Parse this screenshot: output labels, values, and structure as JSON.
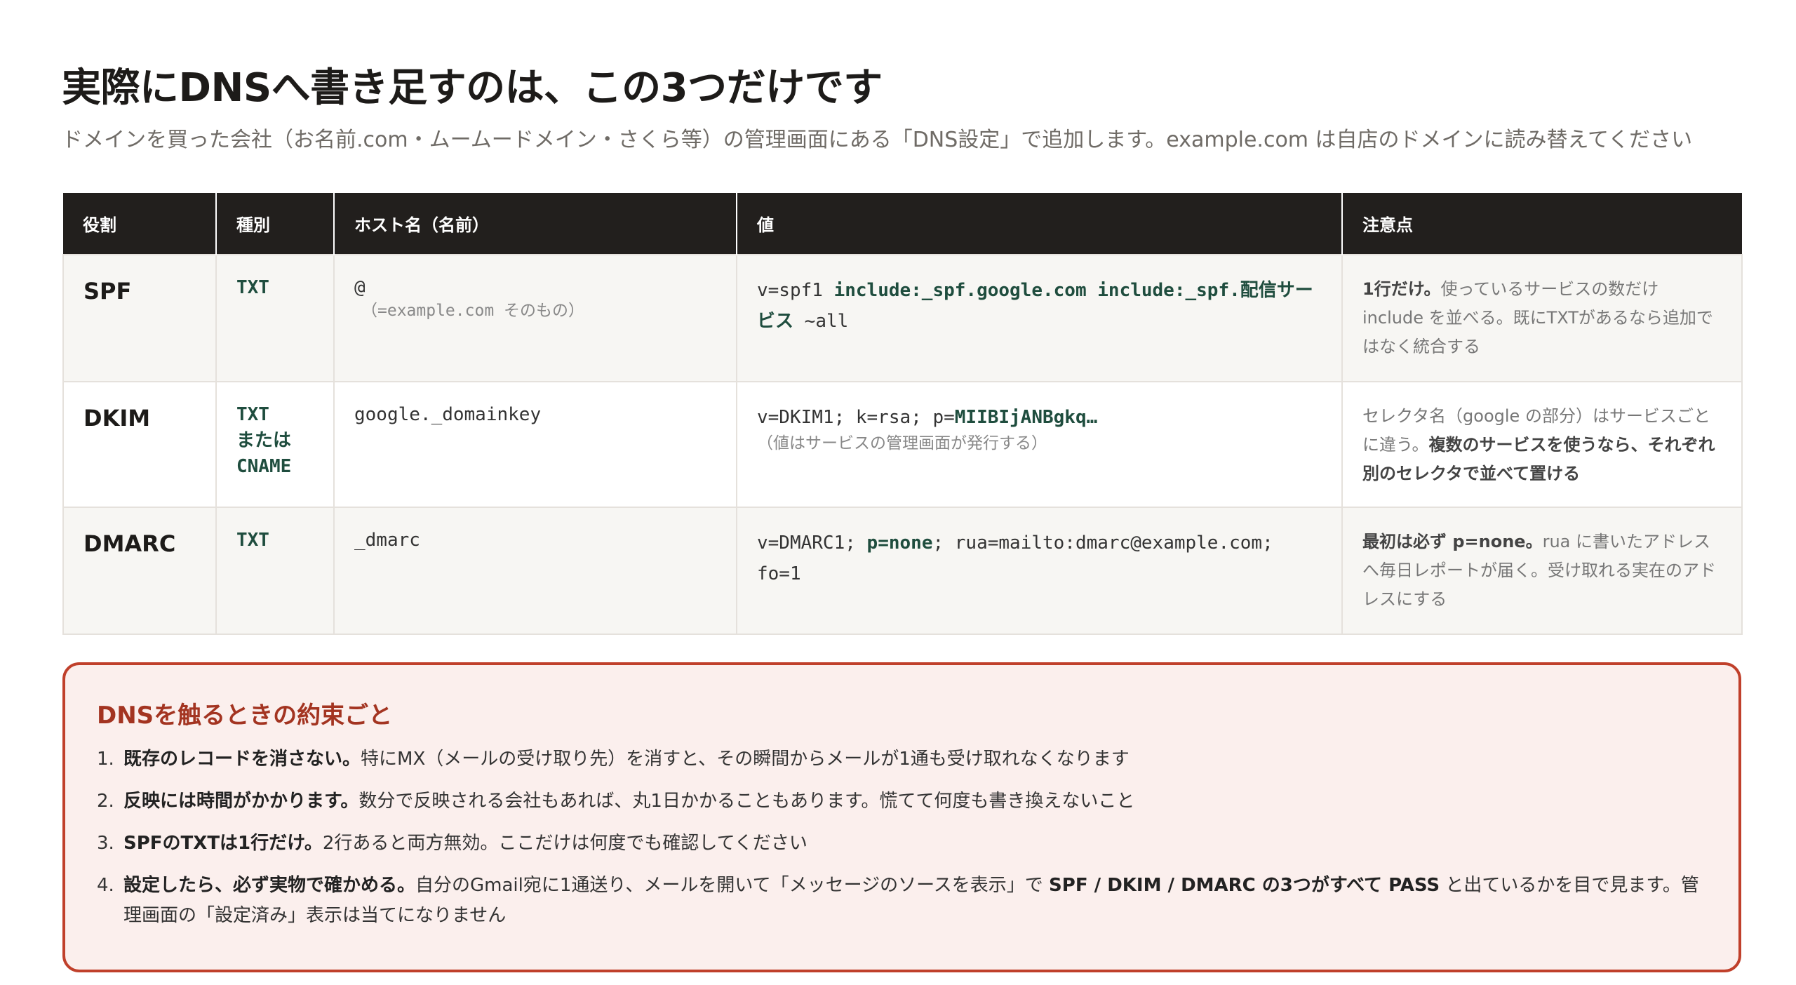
{
  "page": {
    "title": "実際にDNSへ書き足すのは、この3つだけです",
    "subtitle": "ドメインを買った会社（お名前.com・ムームードメイン・さくら等）の管理画面にある「DNS設定」で追加します。example.com は自店のドメインに読み替えてください"
  },
  "table": {
    "headers": [
      "役割",
      "種別",
      "ホスト名（名前）",
      "値",
      "注意点"
    ],
    "rows": [
      {
        "role": "SPF",
        "type": [
          "TXT"
        ],
        "host": "@",
        "host_note": "（=example.com そのもの）",
        "value_parts": [
          {
            "text": "v=spf1 ",
            "bold": false
          },
          {
            "text": "include:_spf.google.com include:_spf.配信サービス",
            "bold": true
          },
          {
            "text": " ~all",
            "bold": false
          }
        ],
        "value_note": "",
        "note_parts": [
          {
            "text": "1行だけ。",
            "bold": true
          },
          {
            "text": "使っているサービスの数だけ include を並べる。既にTXTがあるなら追加ではなく統合する",
            "bold": false
          }
        ]
      },
      {
        "role": "DKIM",
        "type": [
          "TXT",
          "または",
          "CNAME"
        ],
        "host": "google._domainkey",
        "host_note": "",
        "value_parts": [
          {
            "text": "v=DKIM1; k=rsa; p=",
            "bold": false
          },
          {
            "text": "MIIBIjANBgkq…",
            "bold": true
          }
        ],
        "value_note": "（値はサービスの管理画面が発行する）",
        "note_parts": [
          {
            "text": "セレクタ名（google の部分）はサービスごとに違う。",
            "bold": false
          },
          {
            "text": "複数のサービスを使うなら、それぞれ別のセレクタで並べて置ける",
            "bold": true
          }
        ]
      },
      {
        "role": "DMARC",
        "type": [
          "TXT"
        ],
        "host": "_dmarc",
        "host_note": "",
        "value_parts": [
          {
            "text": "v=DMARC1; ",
            "bold": false
          },
          {
            "text": "p=none",
            "bold": true
          },
          {
            "text": "; rua=mailto:dmarc@example.com; fo=1",
            "bold": false
          }
        ],
        "value_note": "",
        "note_parts": [
          {
            "text": "最初は必ず p=none。",
            "bold": true
          },
          {
            "text": "rua に書いたアドレスへ毎日レポートが届く。受け取れる実在のアドレスにする",
            "bold": false
          }
        ]
      }
    ]
  },
  "rules": {
    "title": "DNSを触るときの約束ごと",
    "items": [
      {
        "num": "1.",
        "parts": [
          {
            "text": "既存のレコードを消さない。",
            "bold": true
          },
          {
            "text": "特にMX（メールの受け取り先）を消すと、その瞬間からメールが1通も受け取れなくなります",
            "bold": false
          }
        ]
      },
      {
        "num": "2.",
        "parts": [
          {
            "text": "反映には時間がかかります。",
            "bold": true
          },
          {
            "text": "数分で反映される会社もあれば、丸1日かかることもあります。慌てて何度も書き換えないこと",
            "bold": false
          }
        ]
      },
      {
        "num": "3.",
        "parts": [
          {
            "text": "SPFのTXTは1行だけ。",
            "bold": true
          },
          {
            "text": "2行あると両方無効。ここだけは何度でも確認してください",
            "bold": false
          }
        ]
      },
      {
        "num": "4.",
        "parts": [
          {
            "text": "設定したら、必ず実物で確かめる。",
            "bold": true
          },
          {
            "text": "自分のGmail宛に1通送り、メールを開いて「メッセージのソースを表示」で ",
            "bold": false
          },
          {
            "text": "SPF / DKIM / DMARC の3つがすべて PASS",
            "bold": true
          },
          {
            "text": " と出ているかを目で見ます。管理画面の「設定済み」表示は当てになりません",
            "bold": false
          }
        ]
      }
    ]
  }
}
